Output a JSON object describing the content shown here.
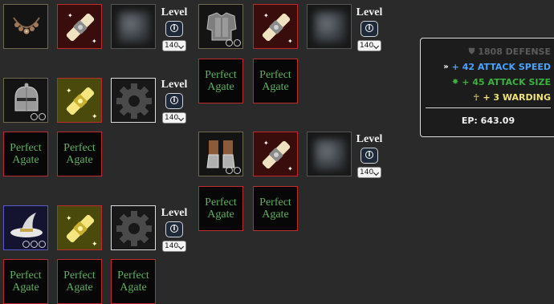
{
  "level": {
    "label": "Level",
    "value": "140",
    "options": [
      "140"
    ]
  },
  "gem_label": "Perfect Agate",
  "stats": {
    "defense": "1808 DEFENSE",
    "attack_speed": "+ 42 ATTACK SPEED",
    "attack_size": "+ 45 ATTACK SIZE",
    "warding": "+ 3 WARDING",
    "ep": "EP: 643.09"
  },
  "colors": {
    "panel_bg": "#1c1c1c",
    "attack_speed": "#4aa3ff",
    "attack_size": "#3cb043",
    "warding": "#f0e27a",
    "gem_text": "#5fae5f",
    "slot_red_border": "#c02a2a"
  },
  "items": [
    {
      "name": "necklace",
      "icon": "necklace-icon"
    },
    {
      "name": "chestplate",
      "icon": "chestplate-icon"
    },
    {
      "name": "helmet",
      "icon": "helmet-icon"
    },
    {
      "name": "boots",
      "icon": "boots-icon"
    },
    {
      "name": "wizard-hat",
      "icon": "wizard-hat-icon"
    }
  ]
}
